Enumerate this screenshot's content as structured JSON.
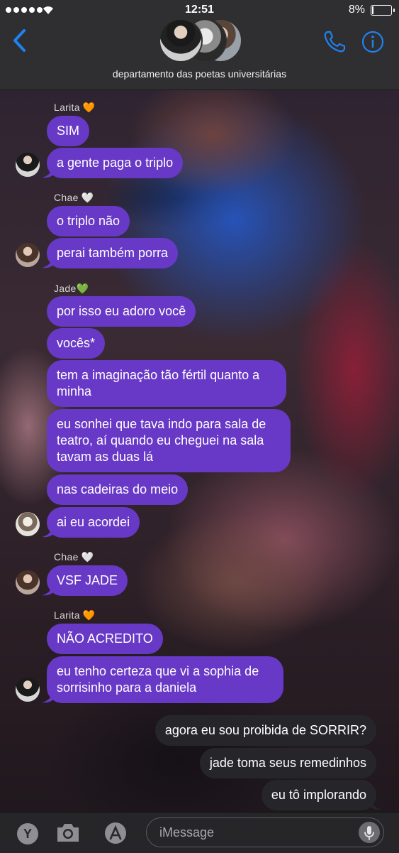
{
  "status_bar": {
    "time": "12:51",
    "battery": "8%"
  },
  "header": {
    "group_name": "departamento das poetas universitárias"
  },
  "messages": {
    "sender_larita": "Larita",
    "heart_larita": "🧡",
    "m1": "SIM",
    "m2": "a gente paga o triplo",
    "sender_chae": "Chae",
    "heart_chae": "🤍",
    "m3": "o triplo não",
    "m4": "perai também porra",
    "sender_jade": "Jade",
    "heart_jade": "💚",
    "m5": "por isso eu adoro você",
    "m6": "vocês*",
    "m7": "tem a imaginação tão fértil quanto a minha",
    "m8": "eu sonhei que tava indo para sala de teatro, aí quando eu cheguei na sala tavam as duas lá",
    "m9": "nas cadeiras do meio",
    "m10": "ai eu acordei",
    "sender_chae2": "Chae",
    "heart_chae2": "🤍",
    "m11": "VSF JADE",
    "sender_larita2": "Larita",
    "heart_larita2": "🧡",
    "m12": "NÃO ACREDITO",
    "m13": "eu tenho certeza que vi a sophia de sorrisinho para a daniela",
    "o1": "agora eu sou proibida de SORRIR?",
    "o2": "jade toma seus remedinhos",
    "o3": "eu tô implorando"
  },
  "input_bar": {
    "placeholder": "iMessage",
    "app_letter": "Y"
  },
  "colors": {
    "incoming_bubble": "#6839c6",
    "outgoing_bubble": "#26262a",
    "accent": "#1e82f0"
  },
  "icons": [
    "chevron-left-icon",
    "phone-icon",
    "info-icon",
    "camera-icon",
    "app-store-icon",
    "microphone-icon"
  ]
}
